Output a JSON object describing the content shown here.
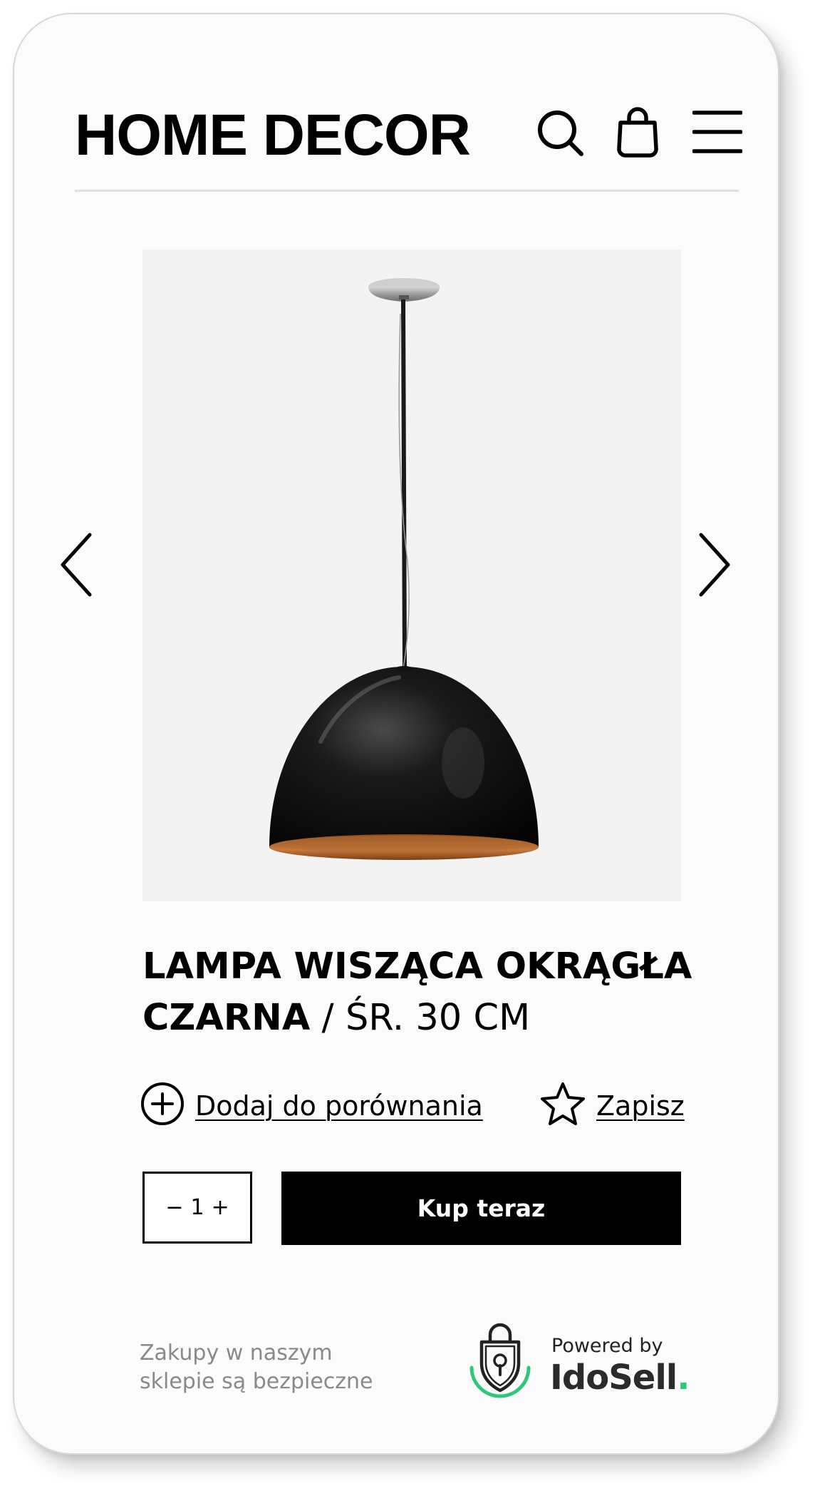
{
  "header": {
    "brand": "HOME DECOR",
    "icons": [
      "search-icon",
      "shopping-bag-icon",
      "menu-icon"
    ]
  },
  "gallery": {
    "image_alt": "Lampa wisząca okrągła czarna",
    "prev_icon": "chevron-left-icon",
    "next_icon": "chevron-right-icon"
  },
  "product": {
    "name": "LAMPA WISZĄCA OKRĄGŁA CZARNA",
    "separator": "/",
    "variant": "ŚR. 30 CM"
  },
  "actions": {
    "compare_label": "Dodaj do porównania",
    "compare_icon": "plus-circle-icon",
    "save_label": "Zapisz",
    "save_icon": "star-icon"
  },
  "cart": {
    "minus": "−",
    "quantity": "1",
    "plus": "+",
    "buy_label": "Kup teraz"
  },
  "footer": {
    "secure_line1": "Zakupy w naszym",
    "secure_line2": "sklepie są bezpieczne",
    "powered_by": "Powered by",
    "brand_name": "IdoSell",
    "brand_dot": ".",
    "badge_icon": "padlock-shield-icon"
  },
  "colors": {
    "background": "#fbfbfb",
    "text": "#000000",
    "secondary_text": "#8a8a8a",
    "button": "#000000",
    "button_text": "#ffffff",
    "image_background": "#f3f3f3",
    "idosell_green": "#2ec878",
    "lamp_interior": "#c77a3c"
  }
}
